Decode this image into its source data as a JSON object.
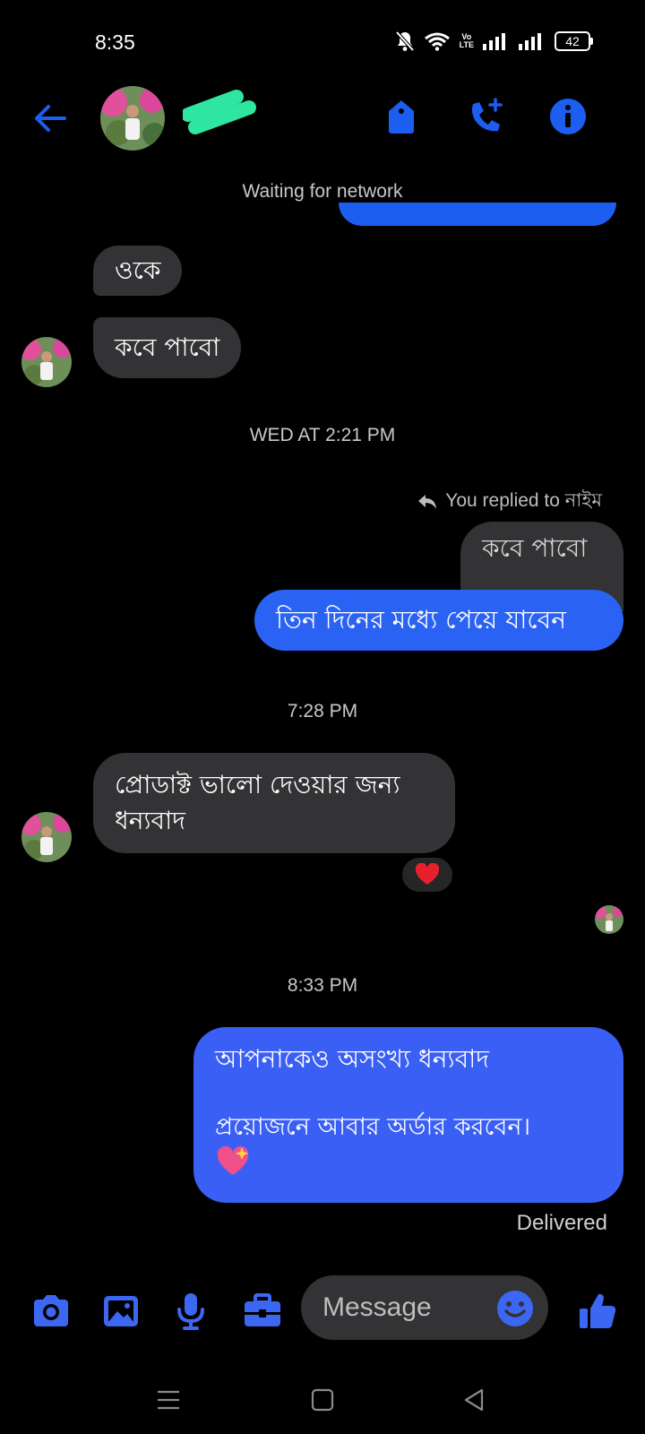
{
  "status_bar": {
    "time": "8:35",
    "battery": "42",
    "volte_top": "Vo",
    "volte_bottom": "LTE"
  },
  "header": {
    "contact_name": "",
    "network_status": "Waiting for network"
  },
  "colors": {
    "accent": "#1b5ef0",
    "outgoing_bubble": "#2a63f3",
    "incoming_bubble": "#333336",
    "redaction": "#2ee6a0"
  },
  "messages": {
    "m1": "ওকে",
    "m2": "কবে পাবো",
    "ts1": "WED AT 2:21 PM",
    "reply_note": "You replied to নাইম",
    "quoted": "কবে পাবো",
    "m3": "তিন দিনের মধ্যে পেয়ে যাবেন",
    "ts2": "7:28 PM",
    "m4_line1": "প্রোডাক্ট ভালো দেওয়ার জন্য",
    "m4_line2": "ধন্যবাদ",
    "reaction": "❤️",
    "ts3": "8:33 PM",
    "m5_line1": "আপনাকেও অসংখ্য ধন্যবাদ",
    "m5_line2": "প্রয়োজনে আবার অর্ডার করবেন।",
    "m5_emoji": "💖",
    "delivered": "Delivered"
  },
  "composer": {
    "placeholder": "Message"
  },
  "icons": {
    "back": "arrow-left-icon",
    "tag": "tag-icon",
    "call": "phone-plus-icon",
    "info": "info-icon",
    "camera": "camera-icon",
    "gallery": "image-icon",
    "mic": "microphone-icon",
    "toolbox": "briefcase-icon",
    "emoji": "smiley-icon",
    "like": "thumbs-up-icon",
    "nav_menu": "menu-icon",
    "nav_home": "square-icon",
    "nav_back": "triangle-back-icon"
  }
}
